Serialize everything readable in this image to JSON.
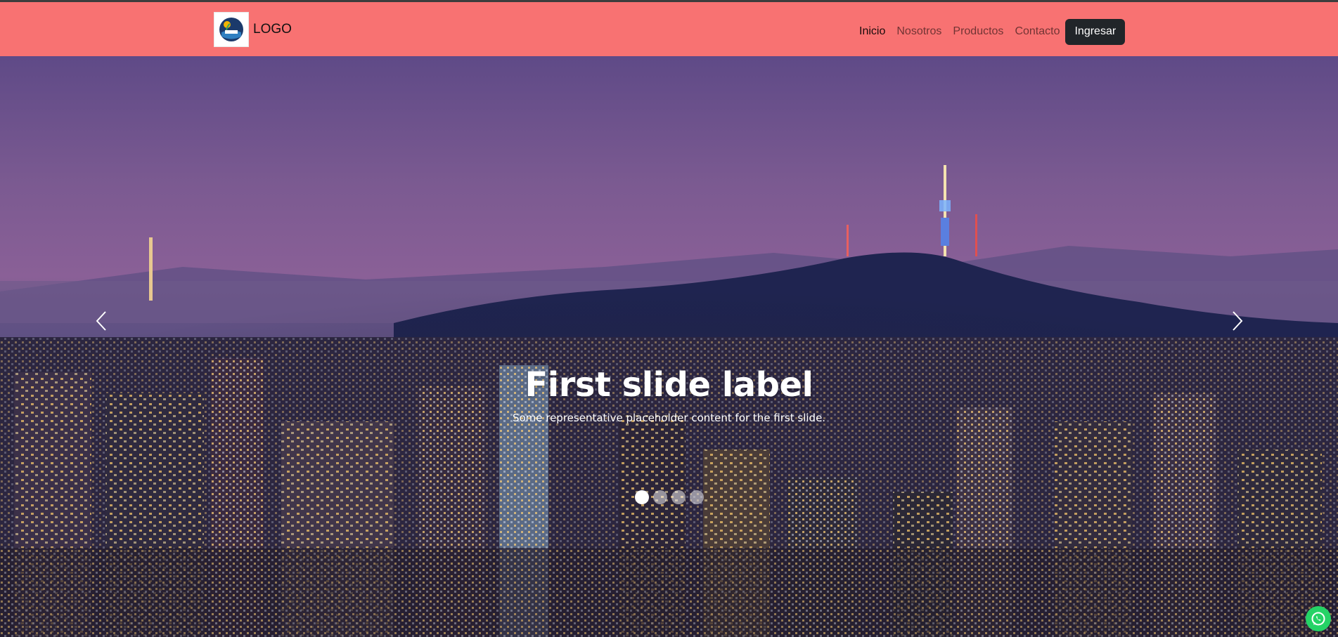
{
  "navbar": {
    "brand_text": "LOGO",
    "links": [
      {
        "label": "Inicio",
        "active": true
      },
      {
        "label": "Nosotros",
        "active": false
      },
      {
        "label": "Productos",
        "active": false
      },
      {
        "label": "Contacto",
        "active": false
      }
    ],
    "login_label": "Ingresar",
    "background_color": "#f87272"
  },
  "carousel": {
    "slide_title": "First slide label",
    "slide_text": "Some representative placeholder content for the first slide.",
    "indicator_count": 4,
    "active_index": 0,
    "prev_icon": "chevron-left-icon",
    "next_icon": "chevron-right-icon"
  },
  "floating_button": {
    "icon": "whatsapp-icon",
    "color": "#25d366"
  }
}
